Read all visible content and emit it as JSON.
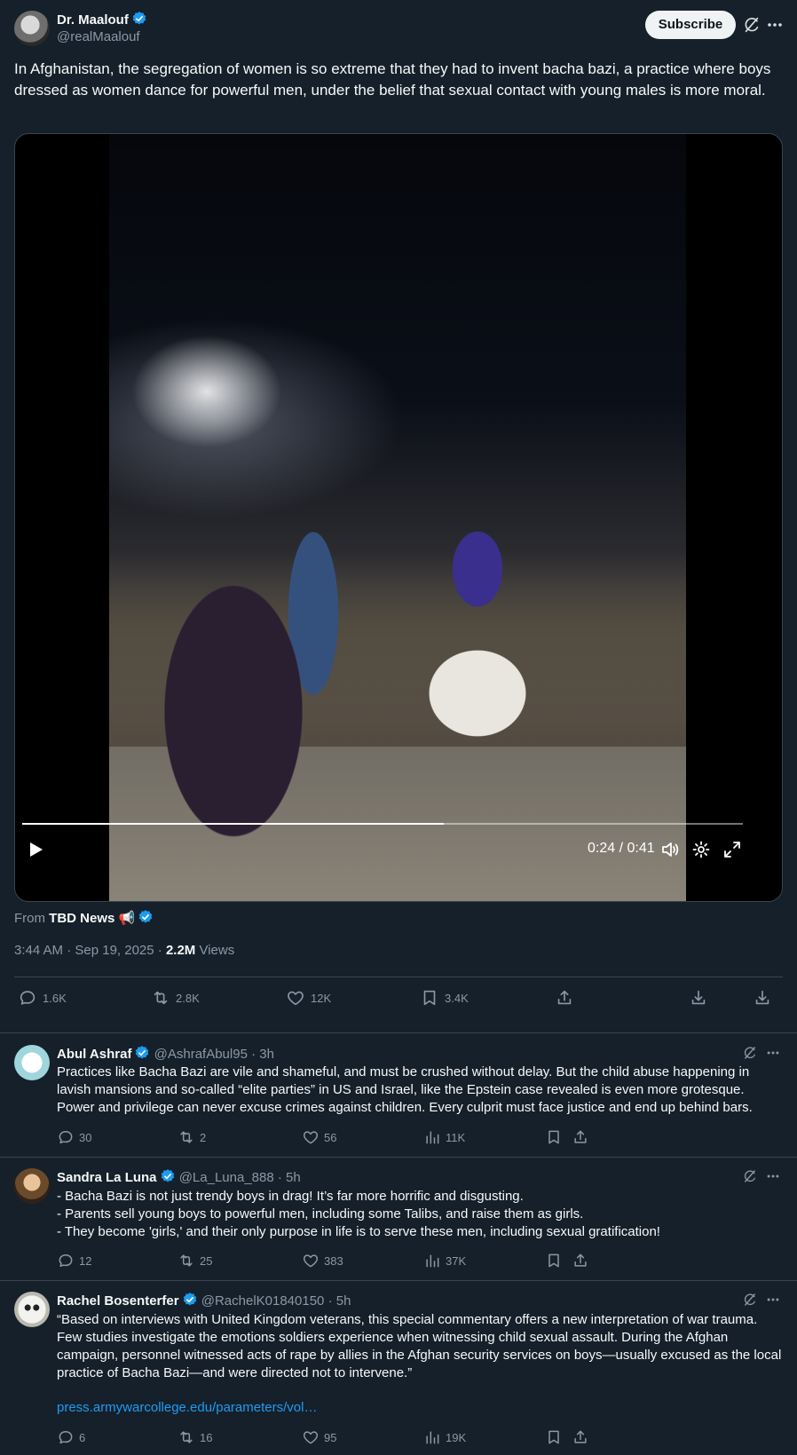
{
  "colors": {
    "background": "#15202b",
    "text": "#f7f9f9",
    "muted": "#8b98a5",
    "accent": "#1d9bf0",
    "border": "#38444d"
  },
  "main_tweet": {
    "author_name": "Dr. Maalouf",
    "author_handle": "@realMaalouf",
    "subscribe_label": "Subscribe",
    "text": "In Afghanistan, the segregation of women is so extreme that they had to invent bacha bazi, a practice where boys dressed as women dance for powerful men, under the belief that sexual contact with young males is more moral.",
    "video": {
      "time": "0:24 / 0:41",
      "progress_fraction": 0.585
    },
    "from_prefix": "From",
    "from_source": "TBD News 📢",
    "timestamp": "3:44 AM · Sep 19, 2025 · ",
    "views_count": "2.2M",
    "views_label": " Views",
    "stats": {
      "replies": "1.6K",
      "reposts": "2.8K",
      "likes": "12K",
      "bookmarks": "3.4K"
    },
    "icons": [
      "grok-icon",
      "more-icon",
      "reply-icon",
      "repost-icon",
      "like-icon",
      "bookmark-icon",
      "share-icon",
      "download-icon",
      "download-icon"
    ]
  },
  "replies": [
    {
      "name": "Abul Ashraf",
      "handle": "@AshrafAbul95",
      "time": " · 3h",
      "text": "Practices like Bacha Bazi are vile and shameful, and must be crushed without delay. But the child abuse happening in lavish mansions and so-called “elite parties” in US and Israel, like the Epstein case revealed is even more grotesque. Power and privilege can never excuse crimes against children. Every culprit must face justice and end up behind bars.",
      "stats": {
        "replies": "30",
        "reposts": "2",
        "likes": "56",
        "views": "11K"
      }
    },
    {
      "name": "Sandra La Luna",
      "handle": "@La_Luna_888",
      "time": " · 5h",
      "lines": [
        "- Bacha Bazi is not just trendy boys in drag! It’s far more horrific and disgusting.",
        "- Parents sell young boys to powerful men, including some Talibs, and raise them as girls.",
        "- They become 'girls,' and their only purpose in life is to serve these men, including sexual gratification!"
      ],
      "stats": {
        "replies": "12",
        "reposts": "25",
        "likes": "383",
        "views": "37K"
      }
    },
    {
      "name": "Rachel Bosenterfer",
      "handle": "@RachelK01840150",
      "time": " · 5h",
      "text": "“Based on interviews with United Kingdom veterans, this special commentary offers a new interpretation of war trauma. Few studies investigate the emotions soldiers experience when witnessing child sexual assault. During the Afghan campaign, personnel witnessed acts of rape by allies in the Afghan security services on boys—usually excused as the local practice of Bacha Bazi—and were directed not to intervene.”",
      "link": "press.armywarcollege.edu/parameters/vol…",
      "stats": {
        "replies": "6",
        "reposts": "16",
        "likes": "95",
        "views": "19K"
      }
    }
  ]
}
